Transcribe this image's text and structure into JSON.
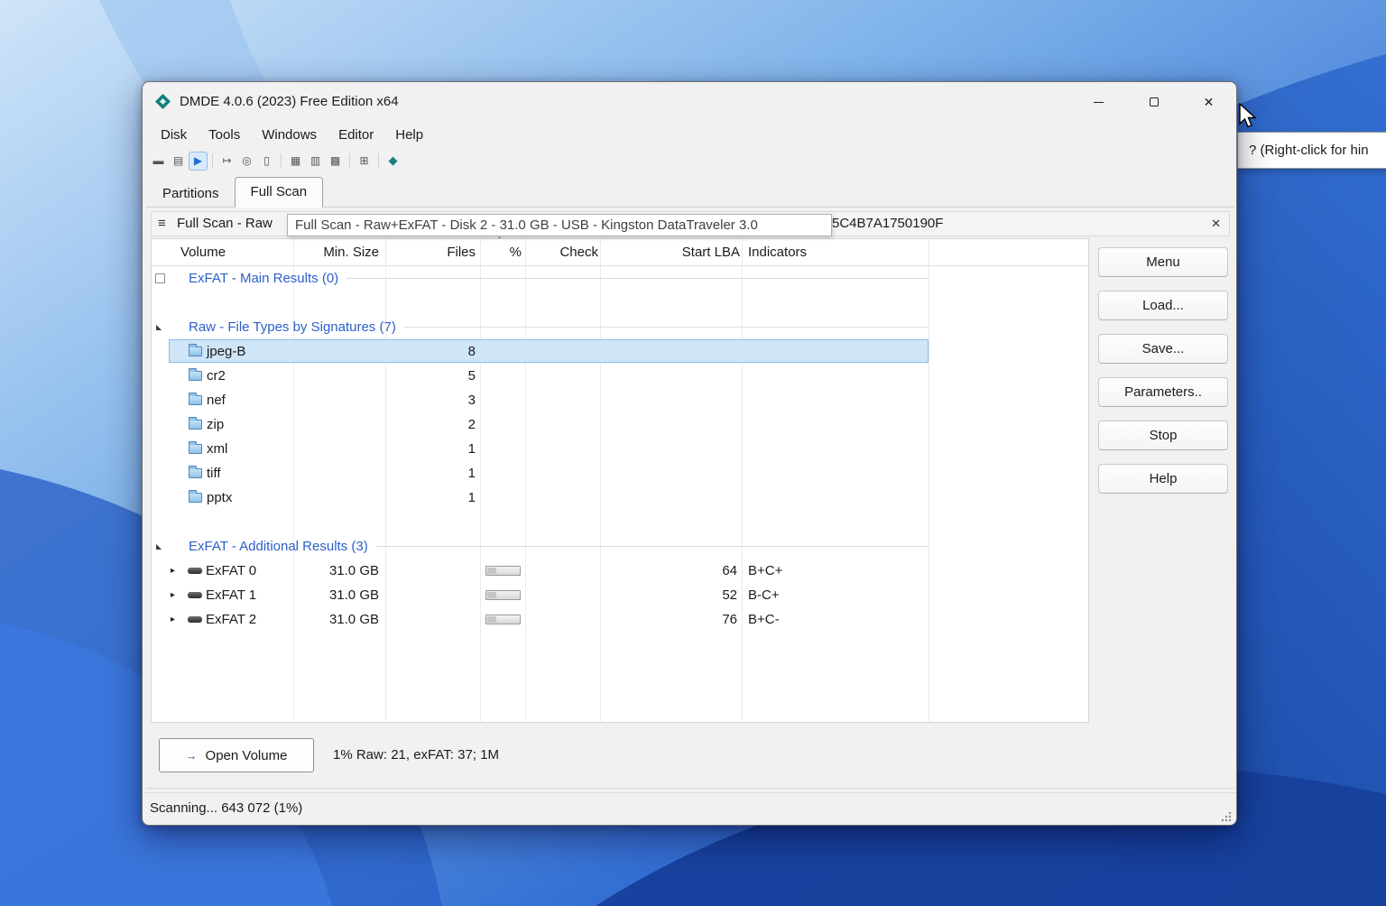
{
  "hint_tooltip": {
    "text": "? (Right-click for hin"
  },
  "icons": {
    "close": "✕",
    "hamburger": "≡",
    "expanded_marker": "◣",
    "expand_arrow": "▸",
    "sort_caret": "ˇ",
    "open_volume_arrow": "→"
  },
  "colors": {
    "link_blue": "#2d5fc8",
    "selection_bg": "#cfe5f8",
    "selection_border": "#8abde8",
    "active_tool_bg": "#d8eafb"
  },
  "app": {
    "title": "DMDE 4.0.6 (2023) Free Edition x64",
    "menu": [
      "Disk",
      "Tools",
      "Windows",
      "Editor",
      "Help"
    ],
    "toolbar_icons": [
      {
        "name": "close-volume-icon",
        "glyph": "▬"
      },
      {
        "name": "device-list-icon",
        "glyph": "▤"
      },
      {
        "name": "full-scan-icon",
        "glyph": "▶"
      },
      {
        "name": "goto-offset-icon",
        "glyph": "↦"
      },
      {
        "name": "search-icon",
        "glyph": "◎"
      },
      {
        "name": "clipboard-icon",
        "glyph": "▯"
      },
      {
        "name": "partitions-view-icon",
        "glyph": "▦"
      },
      {
        "name": "files-view-icon",
        "glyph": "▥"
      },
      {
        "name": "hex-editor-icon",
        "glyph": "▩"
      },
      {
        "name": "windows-cascade-icon",
        "glyph": "⊞"
      },
      {
        "name": "dmde-logo-icon",
        "glyph": "◆"
      }
    ],
    "tabs": [
      {
        "label": "Partitions",
        "active": false
      },
      {
        "label": "Full Scan",
        "active": true
      }
    ],
    "panel": {
      "title_visible": "Full Scan - Raw",
      "title_tail": "5C4B7A1750190F",
      "tooltip": "Full Scan - Raw+ExFAT - Disk 2 - 31.0 GB - USB - Kingston DataTraveler 3.0"
    },
    "table": {
      "headers": {
        "volume": "Volume",
        "min_size": "Min. Size",
        "files": "Files",
        "percent": "%",
        "check": "Check",
        "start_lba": "Start LBA",
        "indicators": "Indicators"
      },
      "main_results": {
        "label": "ExFAT - Main Results (0)"
      },
      "signature_group": {
        "label": "Raw - File Types by Signatures (7)",
        "rows": [
          {
            "name": "jpeg-B",
            "files": "8"
          },
          {
            "name": "cr2",
            "files": "5"
          },
          {
            "name": "nef",
            "files": "3"
          },
          {
            "name": "zip",
            "files": "2"
          },
          {
            "name": "xml",
            "files": "1"
          },
          {
            "name": "tiff",
            "files": "1"
          },
          {
            "name": "pptx",
            "files": "1"
          }
        ]
      },
      "additional_group": {
        "label": "ExFAT - Additional Results (3)",
        "rows": [
          {
            "name": "ExFAT 0",
            "min_size": "31.0 GB",
            "start_lba": "64",
            "indicators": "B+C+"
          },
          {
            "name": "ExFAT 1",
            "min_size": "31.0 GB",
            "start_lba": "52",
            "indicators": "B-C+"
          },
          {
            "name": "ExFAT 2",
            "min_size": "31.0 GB",
            "start_lba": "76",
            "indicators": "B+C-"
          }
        ]
      }
    },
    "side_buttons": [
      "Menu",
      "Load...",
      "Save...",
      "Parameters..",
      "Stop",
      "Help"
    ],
    "footer": {
      "open_volume": "Open Volume",
      "scan_summary": "1% Raw: 21, exFAT: 37; 1M"
    },
    "status_bar": "Scanning... 643 072 (1%)"
  }
}
